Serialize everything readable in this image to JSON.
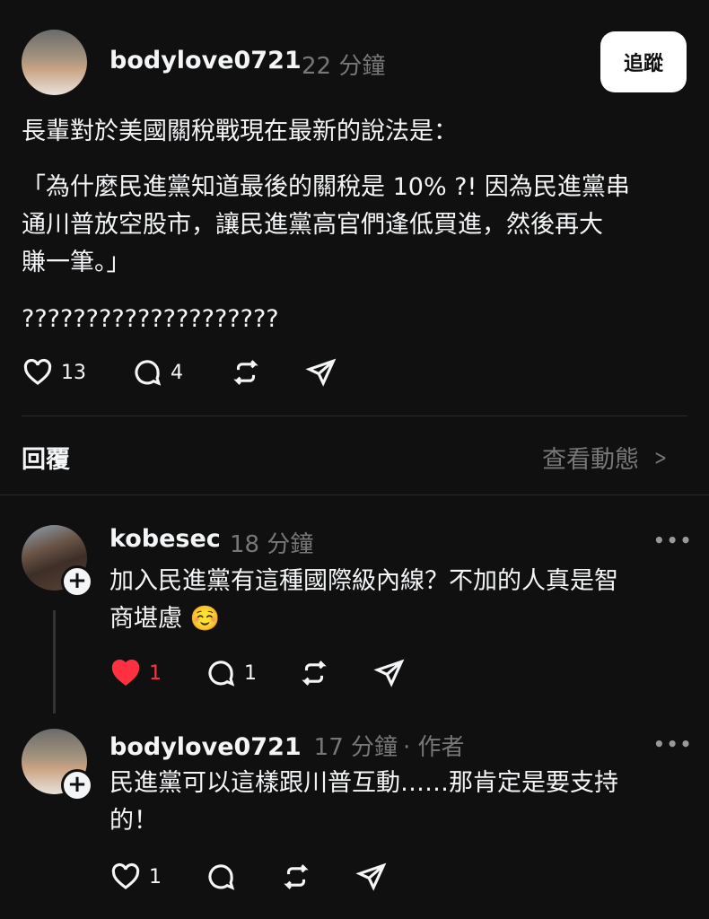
{
  "post": {
    "username": "bodylove0721",
    "time": "22 分鐘",
    "follow_label": "追蹤",
    "paragraphs": [
      "長輩對於美國關稅戰現在最新的說法是：",
      "「為什麼民進黨知道最後的關稅是 10% ?! 因為民進黨串",
      "通川普放空股市，讓民進黨高官們逢低買進，然後再大",
      "賺一筆。」",
      "????????????????????"
    ],
    "likes": "13",
    "comments": "4"
  },
  "replies_section": {
    "title": "回覆",
    "view_activity": "查看動態",
    "chevron": ">"
  },
  "replies": [
    {
      "username": "kobesec",
      "time": "18 分鐘",
      "lines": [
        "加入民進黨有這種國際級內線？不加的人真是智",
        "商堪慮 ☺️"
      ],
      "likes": "1",
      "comments": "1",
      "liked": true
    },
    {
      "username": "bodylove0721",
      "time": "17 分鐘",
      "author_tag": "· 作者",
      "lines": [
        "民進黨可以這樣跟川普互動……那肯定是要支持",
        "的！"
      ],
      "likes": "1"
    }
  ],
  "icons": {
    "more": "more-dots-icon",
    "heart": "heart-icon",
    "comment": "comment-icon",
    "repost": "repost-icon",
    "share": "share-icon",
    "plus": "plus-icon"
  },
  "colors": {
    "background": "#101010",
    "text": "#f3f5f7",
    "muted": "#777777",
    "liked_red": "#ff3040",
    "follow_bg": "#ffffff"
  },
  "more_glyph": "•••",
  "plus_glyph": "+"
}
